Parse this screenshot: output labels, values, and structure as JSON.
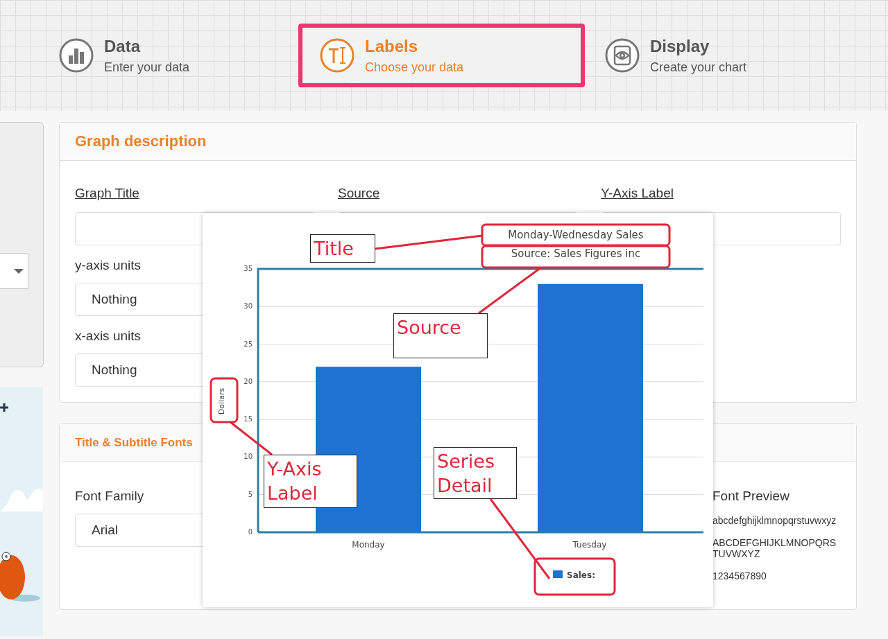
{
  "steps": [
    {
      "kind": "data",
      "title": "Data",
      "subtitle": "Enter your data",
      "selected": false
    },
    {
      "kind": "labels",
      "title": "Labels",
      "subtitle": "Choose your data",
      "selected": true
    },
    {
      "kind": "display",
      "title": "Display",
      "subtitle": "Create your chart",
      "selected": false
    }
  ],
  "graph_description": {
    "title": "Graph description",
    "fields": [
      {
        "label": "Graph Title"
      },
      {
        "label": "Source"
      },
      {
        "label": "Y-Axis Label"
      }
    ],
    "selects": [
      {
        "label": "y-axis units",
        "value": "Nothing"
      },
      {
        "label": "x-axis units",
        "value": "Nothing"
      }
    ]
  },
  "title_fonts": {
    "title": "Title & Subtitle Fonts",
    "font_family": {
      "label": "Font Family",
      "value": "Arial"
    },
    "preview": {
      "label": "Font Preview",
      "lines": [
        "abcdefghijklmnopqrstuvwxyz",
        "ABCDEFGHIJKLMNOPQRSTUVWXYZ",
        "1234567890"
      ]
    }
  },
  "example_overlay": {
    "subtitle": "Source: Sales Figures inc",
    "callouts": [
      {
        "kind": "title",
        "text": "Title"
      },
      {
        "kind": "source",
        "text": "Source"
      },
      {
        "kind": "yaxis",
        "text": "Y-Axis Label"
      },
      {
        "kind": "series",
        "text": "Series Detail"
      }
    ],
    "chart_data": {
      "type": "bar",
      "title": "Monday-Wednesday Sales",
      "ylabel": "Dollars",
      "categories": [
        "Monday",
        "Tuesday"
      ],
      "series": [
        {
          "name": "Sales:",
          "color": "#1e73d2",
          "values": [
            22,
            33
          ]
        }
      ],
      "ylim": [
        0,
        35
      ],
      "grid": true,
      "yticks": [
        0,
        5,
        10,
        15,
        20,
        25,
        30,
        35
      ]
    }
  }
}
